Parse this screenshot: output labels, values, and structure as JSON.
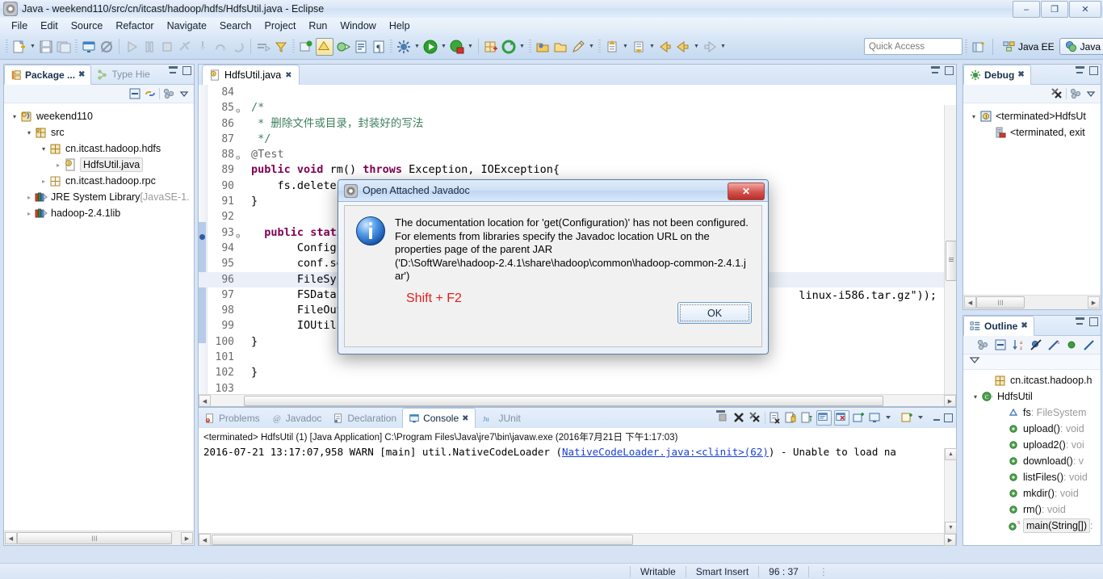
{
  "window": {
    "title": "Java - weekend110/src/cn/itcast/hadoop/hdfs/HdfsUtil.java - Eclipse",
    "minimize_label": "–",
    "restore_label": "❐",
    "close_label": "✕"
  },
  "menubar": [
    "File",
    "Edit",
    "Source",
    "Refactor",
    "Navigate",
    "Search",
    "Project",
    "Run",
    "Window",
    "Help"
  ],
  "toolbar": {
    "quick_access_placeholder": "Quick Access",
    "perspectives": [
      {
        "label": "Java EE",
        "active": false
      },
      {
        "label": "Java",
        "active": true
      }
    ]
  },
  "package_explorer": {
    "tabs": [
      {
        "label": "Package ...",
        "active": true,
        "icon": "package-explorer-icon"
      },
      {
        "label": "Type Hie",
        "active": false,
        "icon": "type-hierarchy-icon"
      }
    ],
    "tree": [
      {
        "label": "weekend110",
        "indent": 0,
        "twist": "open",
        "icon": "java-project-icon",
        "selected": false
      },
      {
        "label": "src",
        "indent": 1,
        "twist": "open",
        "icon": "source-folder-icon",
        "selected": false
      },
      {
        "label": "cn.itcast.hadoop.hdfs",
        "indent": 2,
        "twist": "open",
        "icon": "package-icon",
        "selected": false
      },
      {
        "label": "HdfsUtil.java",
        "indent": 3,
        "twist": "closed",
        "icon": "java-file-icon",
        "selected": true
      },
      {
        "label": "cn.itcast.hadoop.rpc",
        "indent": 2,
        "twist": "closed",
        "icon": "package-empty-icon",
        "selected": false
      },
      {
        "label": "JRE System Library",
        "suffix": " [JavaSE-1.",
        "indent": 1,
        "twist": "closed",
        "icon": "library-icon",
        "selected": false
      },
      {
        "label": "hadoop-2.4.1lib",
        "indent": 1,
        "twist": "closed",
        "icon": "library-icon",
        "selected": false
      }
    ]
  },
  "editor": {
    "tab": {
      "label": "HdfsUtil.java",
      "icon": "java-file-icon",
      "close": "✖"
    },
    "lines": [
      {
        "num": "84",
        "fold": "",
        "html": "",
        "hl": false
      },
      {
        "num": "85",
        "fold": "⊝",
        "html": "<span class='cmt'>/*</span>",
        "hl": false
      },
      {
        "num": "86",
        "fold": "",
        "html": "<span class='cmt'> * 删除文件或目录，封装好的写法</span>",
        "hl": false
      },
      {
        "num": "87",
        "fold": "",
        "html": "<span class='cmt'> */</span>",
        "hl": false
      },
      {
        "num": "88",
        "fold": "⊝",
        "html": "<span class='ann'>@Test</span>",
        "hl": false
      },
      {
        "num": "89",
        "fold": "",
        "html": "<span class='kw'>public</span> <span class='kw'>void</span> rm() <span class='kw'>throws</span> Exception, IOException{",
        "hl": false
      },
      {
        "num": "90",
        "fold": "",
        "html": "    fs.delete(n",
        "hl": false
      },
      {
        "num": "91",
        "fold": "",
        "html": "}",
        "hl": false
      },
      {
        "num": "92",
        "fold": "",
        "html": "",
        "hl": false
      },
      {
        "num": "93",
        "fold": "⊝",
        "html": "  <span class='kw'>public</span> <span class='kw'>static</span>",
        "hl": false
      },
      {
        "num": "94",
        "fold": "",
        "html": "       Configu",
        "hl": false
      },
      {
        "num": "95",
        "fold": "",
        "html": "       conf.se",
        "hl": false
      },
      {
        "num": "96",
        "fold": "",
        "html": "       FileSys",
        "hl": true
      },
      {
        "num": "97",
        "fold": "",
        "html": "       FSDataI",
        "hl": false
      },
      {
        "num": "98",
        "fold": "",
        "html": "       FileOut",
        "hl": false
      },
      {
        "num": "99",
        "fold": "",
        "html": "       IOUtils",
        "hl": false
      },
      {
        "num": "100",
        "fold": "",
        "html": "}",
        "hl": false
      },
      {
        "num": "101",
        "fold": "",
        "html": "",
        "hl": false
      },
      {
        "num": "102",
        "fold": "",
        "html": "}",
        "hl": false
      },
      {
        "num": "103",
        "fold": "",
        "html": "",
        "hl": false
      }
    ],
    "tail_fragment": "linux-i586.tar.gz\"));"
  },
  "console": {
    "tabs": [
      {
        "label": "Problems",
        "active": false,
        "icon": "problems-icon"
      },
      {
        "label": "Javadoc",
        "active": false,
        "icon": "javadoc-icon"
      },
      {
        "label": "Declaration",
        "active": false,
        "icon": "declaration-icon"
      },
      {
        "label": "Console",
        "active": true,
        "icon": "console-icon"
      },
      {
        "label": "JUnit",
        "active": false,
        "icon": "junit-icon"
      }
    ],
    "header": "<terminated> HdfsUtil (1) [Java Application] C:\\Program Files\\Java\\jre7\\bin\\javaw.exe (2016年7月21日 下午1:17:03)",
    "log_pre": "2016-07-21 13:17:07,958 WARN  [main] util.NativeCodeLoader (",
    "log_link": "NativeCodeLoader.java:<clinit>(62)",
    "log_post": ") - Unable to load na"
  },
  "debug_view": {
    "tab": {
      "label": "Debug",
      "icon": "debug-icon"
    },
    "items": [
      {
        "label": "<terminated>HdfsUt",
        "indent": 0,
        "twist": "open",
        "icon": "launch-config-icon"
      },
      {
        "label": "<terminated, exit",
        "indent": 1,
        "twist": "",
        "icon": "terminated-process-icon"
      }
    ]
  },
  "outline_view": {
    "tab": {
      "label": "Outline",
      "icon": "outline-icon"
    },
    "items": [
      {
        "label": "cn.itcast.hadoop.h",
        "indent": 1,
        "twist": "",
        "icon": "package-icon",
        "selected": false,
        "type": ""
      },
      {
        "label": "HdfsUtil",
        "indent": 0,
        "twist": "open",
        "icon": "class-icon",
        "selected": false,
        "type": ""
      },
      {
        "label": "fs",
        "type": " : FileSystem",
        "indent": 2,
        "twist": "",
        "icon": "field-icon",
        "selected": false
      },
      {
        "label": "upload()",
        "type": " : void",
        "indent": 2,
        "twist": "",
        "icon": "method-icon",
        "selected": false
      },
      {
        "label": "upload2()",
        "type": " : voi",
        "indent": 2,
        "twist": "",
        "icon": "method-icon",
        "selected": false
      },
      {
        "label": "download()",
        "type": " : v",
        "indent": 2,
        "twist": "",
        "icon": "method-icon",
        "selected": false
      },
      {
        "label": "listFiles()",
        "type": " : void",
        "indent": 2,
        "twist": "",
        "icon": "method-icon",
        "selected": false
      },
      {
        "label": "mkdir()",
        "type": " : void",
        "indent": 2,
        "twist": "",
        "icon": "method-icon",
        "selected": false
      },
      {
        "label": "rm()",
        "type": " : void",
        "indent": 2,
        "twist": "",
        "icon": "method-icon",
        "selected": false
      },
      {
        "label": "main(String[])",
        "type": " :",
        "indent": 2,
        "twist": "",
        "icon": "static-method-icon",
        "selected": true
      }
    ]
  },
  "statusbar": {
    "writable": "Writable",
    "insert_mode": "Smart Insert",
    "position": "96 : 37"
  },
  "dialog": {
    "title": "Open Attached Javadoc",
    "title_icon": "eclipse-icon",
    "close_label": "✕",
    "message": "The documentation location for 'get(Configuration)' has not been configured.\nFor elements from libraries specify the Javadoc location URL on the\nproperties page of the parent JAR\n('D:\\SoftWare\\hadoop-2.4.1\\share\\hadoop\\common\\hadoop-common-2.4.1.j\nar')",
    "shortcut_hint": "Shift + F2",
    "ok_label": "OK",
    "shortcut_color": "#e02020"
  }
}
